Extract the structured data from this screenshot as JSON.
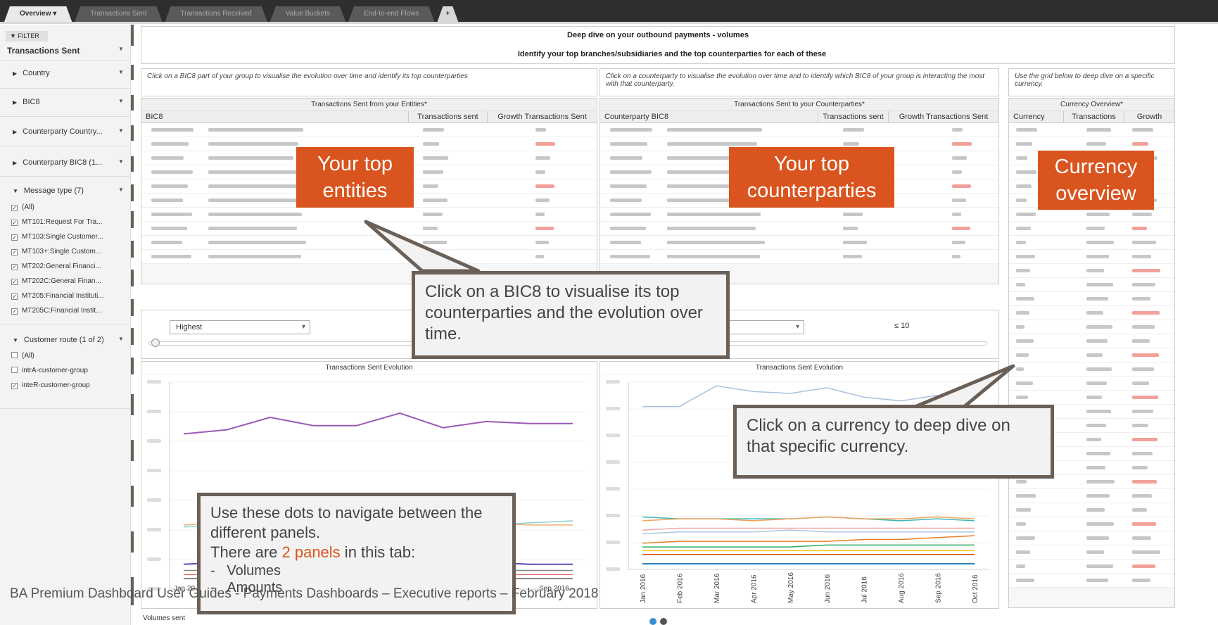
{
  "tabs": [
    "Overview ▾",
    "Transactions Sent",
    "Transactions Received",
    "Value Buckets",
    "End-to-end Flows",
    "+"
  ],
  "sidebar": {
    "filter_label": "▼ FILTER",
    "selected": "Transactions Sent",
    "groups": [
      "Country",
      "BIC8",
      "Counterparty Country...",
      "Counterparty BIC8 (1..."
    ],
    "message_type_label": "Message type (7)",
    "message_types": [
      "(All)",
      "MT101:Request For Tra...",
      "MT103:Single Customer...",
      "MT103+:Single Custom...",
      "MT202:General Financi...",
      "MT202C:General Finan...",
      "MT205:Financial Instituti...",
      "MT205C:Financial Instit..."
    ],
    "customer_route_label": "Customer route (1 of 2)",
    "customer_routes": [
      {
        "label": "(All)",
        "checked": false
      },
      {
        "label": "intrA-customer-group",
        "checked": false
      },
      {
        "label": "inteR-customer-group",
        "checked": true
      }
    ]
  },
  "header": {
    "title": "Deep dive on your outbound payments - volumes",
    "subtitle": "Identify your top branches/subsidiaries and the top counterparties for each of these"
  },
  "info": {
    "left": "Click on a BIC8 part of your group to visualise the evolution over time and identify its top counterparties",
    "middle": "Click on a counterparty to visualise the evolution over time and to identify which BIC8 of your group is interacting the most with that counterparty.",
    "right": "Use the grid below to deep dive on a specific currency."
  },
  "tables": {
    "entities": {
      "title": "Transactions Sent from your Entities*",
      "columns": [
        "BIC8",
        "Transactions sent",
        "Growth Transactions Sent"
      ]
    },
    "counterparties": {
      "title": "Transactions Sent to your Counterparties*",
      "columns": [
        "Counterparty BIC8",
        "Transactions sent",
        "Growth Transactions Sent"
      ]
    },
    "currency": {
      "title": "Currency Overview*",
      "columns": [
        "Currency",
        "Transactions",
        "Growth"
      ]
    }
  },
  "controls": {
    "dropdown_left": "Highest",
    "le_label": "≤ 10"
  },
  "charts": {
    "left_title": "Transactions Sent Evolution",
    "right_title": "Transactions Sent Evolution"
  },
  "chart_data": {
    "type": "line",
    "x": [
      "Jan 2016",
      "Feb 2016",
      "Mar 2016",
      "Apr 2016",
      "May 2016",
      "Jun 2016",
      "Jul 2016",
      "Aug 2016",
      "Sep 2016",
      "Oct 2016"
    ]
  },
  "left_axis_visible": [
    "Jan 20",
    "Sep 2016"
  ],
  "overlays": {
    "entities_label": "Your top entities",
    "counterparties_label": "Your top counterparties",
    "currency_label": "Currency overview",
    "callout_bic8": "Click on a BIC8 to visualise its top counterparties and the evolution over time.",
    "callout_currency": "Click on a currency to deep dive on that specific currency.",
    "callout_dots_1": "Use these dots to navigate between the different panels.",
    "callout_dots_2a": "There are ",
    "callout_dots_2b": "2 panels",
    "callout_dots_2c": " in this tab:",
    "callout_dots_items": [
      "Volumes",
      "Amounts"
    ]
  },
  "footer": {
    "volumes_sent": "Volumes sent",
    "doc_text": "BA Premium Dashboard User Guides - Payments Dashboards – Executive reports – February 2018"
  },
  "colors": {
    "accent": "#d9541e",
    "callout_border": "#6b6057",
    "dot_active": "#3a8fd0",
    "dot_inactive": "#555555"
  }
}
